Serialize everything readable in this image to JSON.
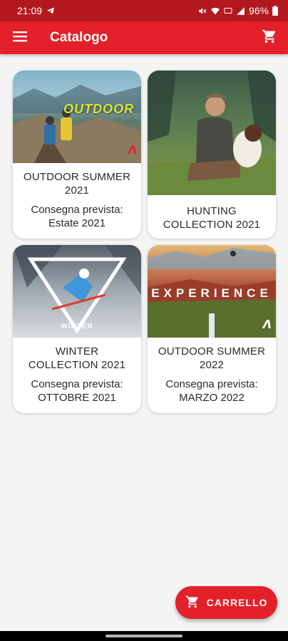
{
  "status_bar": {
    "time": "21:09",
    "battery_percent": "96%",
    "icons": [
      "telegram-icon",
      "mute-icon",
      "wifi-icon",
      "hd-signal-icon",
      "signal-icon",
      "battery-icon"
    ]
  },
  "app_bar": {
    "title": "Catalogo",
    "menu_icon": "hamburger-menu-icon",
    "cart_icon": "shopping-cart-icon"
  },
  "catalog": [
    {
      "title": "OUTDOOR SUMMER 2021",
      "delivery": "Consegna prevista: Estate 2021",
      "image_label": "OUTDOOR"
    },
    {
      "title": "HUNTING COLLECTION 2021",
      "delivery": ""
    },
    {
      "title": "WINTER COLLECTION 2021",
      "delivery": "Consegna prevista: OTTOBRE 2021",
      "image_label": "WINTER"
    },
    {
      "title": "OUTDOOR SUMMER 2022",
      "delivery": "Consegna prevista: MARZO 2022",
      "image_label": "EXPERIENCE"
    }
  ],
  "fab": {
    "label": "CARRELLO",
    "icon": "shopping-cart-icon"
  },
  "colors": {
    "primary": "#e4202a",
    "status_bar": "#b3181e",
    "background": "#f4f4f4",
    "card": "#ffffff"
  }
}
